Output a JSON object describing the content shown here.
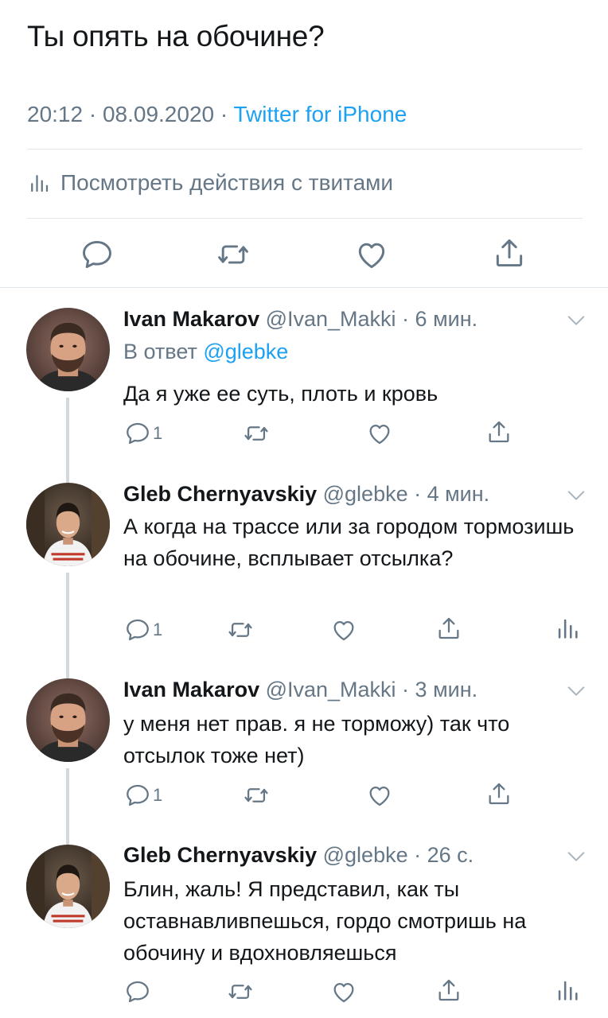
{
  "main_tweet": {
    "text": "Ты опять на обочине?",
    "timestamp": "20:12 · 08.09.2020 · ",
    "source": "Twitter for iPhone",
    "activity_label": "Посмотреть действия с твитами"
  },
  "replies": [
    {
      "name": "Ivan Makarov",
      "meta": " @Ivan_Makki · 6 мин.",
      "reply_prefix": "В ответ ",
      "reply_mention": "@glebke",
      "text": "Да я уже ее суть, плоть и кровь",
      "reply_count": "1"
    },
    {
      "name": "Gleb Chernyavskiy",
      "meta": " @glebke · 4 мин.",
      "text": "А когда на трассе или за городом тормозишь на обочине, всплывает отсылка?",
      "reply_count": "1"
    },
    {
      "name": "Ivan Makarov",
      "meta": " @Ivan_Makki · 3 мин.",
      "text": "у меня нет прав. я не торможу) так что отсылок тоже нет)",
      "reply_count": "1"
    },
    {
      "name": "Gleb Chernyavskiy",
      "meta": " @glebke · 26 с.",
      "text": "Блин, жаль! Я представил, как ты оставнавливпешься, гордо смотришь на обочину и вдохновляешься",
      "reply_count": ""
    }
  ],
  "icons": {
    "reply": "reply-icon",
    "retweet": "retweet-icon",
    "like": "heart-icon",
    "share": "share-icon",
    "analytics": "analytics-icon",
    "chevron": "chevron-down-icon"
  },
  "colors": {
    "text": "#14171a",
    "secondary": "#657786",
    "accent": "#1da1f2",
    "divider": "#e1e8ed"
  }
}
